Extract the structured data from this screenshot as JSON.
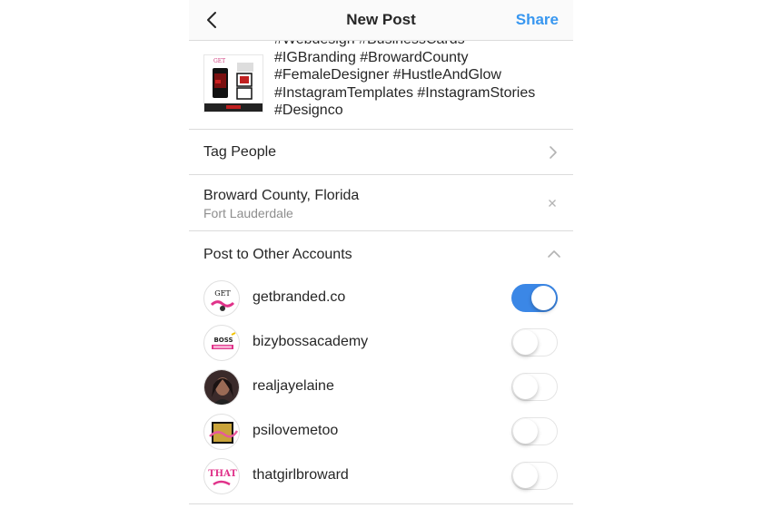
{
  "header": {
    "title": "New Post",
    "share_label": "Share",
    "share_color": "#3897f0"
  },
  "caption": {
    "text": "#Webdesign #BusinessCards\n#IGBranding #BrowardCounty\n#FemaleDesigner #HustleAndGlow\n#InstagramTemplates #InstagramStories\n#Designco",
    "thumbnail_caption": "GET"
  },
  "tag_people": {
    "label": "Tag People"
  },
  "location": {
    "name": "Broward County, Florida",
    "sub": "Fort Lauderdale"
  },
  "other_accounts": {
    "label": "Post to Other Accounts",
    "accounts": [
      {
        "name": "getbranded.co",
        "enabled": true,
        "avatar_text": "GET"
      },
      {
        "name": "bizybossacademy",
        "enabled": false,
        "avatar_text": "BOSS"
      },
      {
        "name": "realjayelaine",
        "enabled": false,
        "avatar_text": ""
      },
      {
        "name": "psilovemetoo",
        "enabled": false,
        "avatar_text": ""
      },
      {
        "name": "thatgirlbroward",
        "enabled": false,
        "avatar_text": "THAT"
      }
    ]
  },
  "colors": {
    "toggle_on": "#3b87e6",
    "divider": "#dbdbdb",
    "accent": "#3897f0"
  }
}
